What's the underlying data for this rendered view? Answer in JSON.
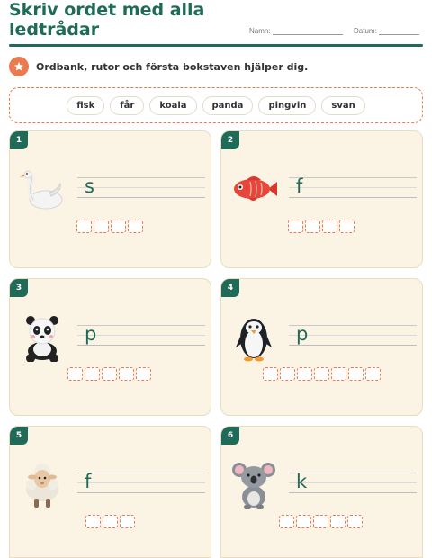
{
  "header": {
    "title": "Skriv ordet med alla ledtrådar",
    "name_label": "Namn:",
    "date_label": "Datum:"
  },
  "instruction": {
    "icon": "star-icon",
    "text": "Ordbank, rutor och första bokstaven hjälper dig."
  },
  "word_bank": [
    "fisk",
    "får",
    "koala",
    "panda",
    "pingvin",
    "svan"
  ],
  "cards": [
    {
      "number": "1",
      "picture": "swan",
      "first_letter": "s",
      "letter_count": 4
    },
    {
      "number": "2",
      "picture": "fish",
      "first_letter": "f",
      "letter_count": 4
    },
    {
      "number": "3",
      "picture": "panda",
      "first_letter": "p",
      "letter_count": 5
    },
    {
      "number": "4",
      "picture": "penguin",
      "first_letter": "p",
      "letter_count": 7
    },
    {
      "number": "5",
      "picture": "sheep",
      "first_letter": "f",
      "letter_count": 3
    },
    {
      "number": "6",
      "picture": "koala",
      "first_letter": "k",
      "letter_count": 5
    }
  ],
  "colors": {
    "accent": "#1f6b57",
    "orange": "#ea7a4f",
    "card_bg": "#fbf3e4"
  }
}
